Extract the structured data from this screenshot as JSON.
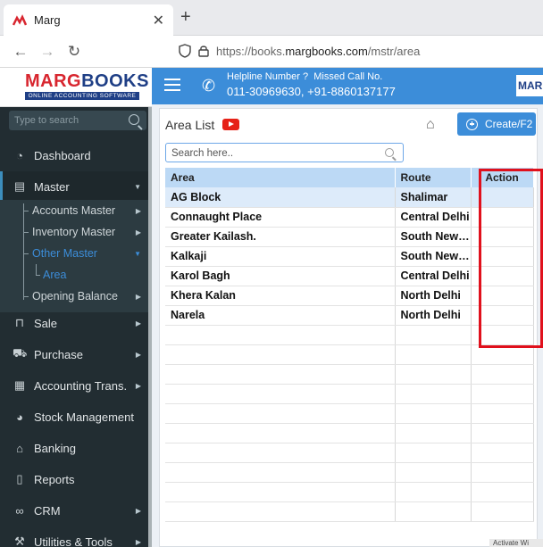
{
  "browser": {
    "tab_title": "Marg",
    "tab_close": "✕",
    "new_tab": "+",
    "url_prefix": "https://books.",
    "url_domain": "margbooks.com",
    "url_path": "/mstr/area"
  },
  "brand": {
    "name_part1": "MARG",
    "name_part2": "BOOKS",
    "tagline": "ONLINE ACCOUNTING SOFTWARE",
    "mini": "MAR"
  },
  "header": {
    "helpline_label": "Helpline Number ?",
    "missed_call_label": "Missed Call No.",
    "phones": "011-30969630, +91-8860137177"
  },
  "sidebar": {
    "search_placeholder": "Type to search",
    "items": [
      {
        "label": "Dashboard",
        "icon": "dashboard-icon"
      },
      {
        "label": "Master",
        "icon": "master-icon"
      },
      {
        "label": "Sale",
        "icon": "bag-icon"
      },
      {
        "label": "Purchase",
        "icon": "cart-icon"
      },
      {
        "label": "Accounting Trans.",
        "icon": "calculator-icon"
      },
      {
        "label": "Stock Management",
        "icon": "pie-chart-icon"
      },
      {
        "label": "Banking",
        "icon": "bank-icon"
      },
      {
        "label": "Reports",
        "icon": "document-icon"
      },
      {
        "label": "CRM",
        "icon": "handshake-icon"
      },
      {
        "label": "Utilities & Tools",
        "icon": "tools-icon"
      }
    ],
    "master_sub": [
      {
        "label": "Accounts Master"
      },
      {
        "label": "Inventory Master"
      },
      {
        "label": "Other Master"
      },
      {
        "label": "Area"
      },
      {
        "label": "Opening Balance"
      }
    ]
  },
  "page": {
    "title": "Area List",
    "create_label": "Create/F2",
    "search_placeholder": "Search here.."
  },
  "grid": {
    "columns": [
      "Area",
      "Route",
      "Action"
    ],
    "rows": [
      {
        "area": "AG Block",
        "route": "Shalimar"
      },
      {
        "area": "Connaught Place",
        "route": "Central Delhi"
      },
      {
        "area": "Greater Kailash.",
        "route": "South New …"
      },
      {
        "area": "Kalkaji",
        "route": "South New …"
      },
      {
        "area": "Karol Bagh",
        "route": "Central Delhi"
      },
      {
        "area": "Khera Kalan",
        "route": "North Delhi"
      },
      {
        "area": "Narela",
        "route": "North Delhi"
      }
    ],
    "empty_rows": 10
  },
  "status": {
    "text": "Activate Wi"
  },
  "colors": {
    "accent": "#3c8dd9",
    "sidebar": "#222d32",
    "highlight": "#e0101c"
  }
}
